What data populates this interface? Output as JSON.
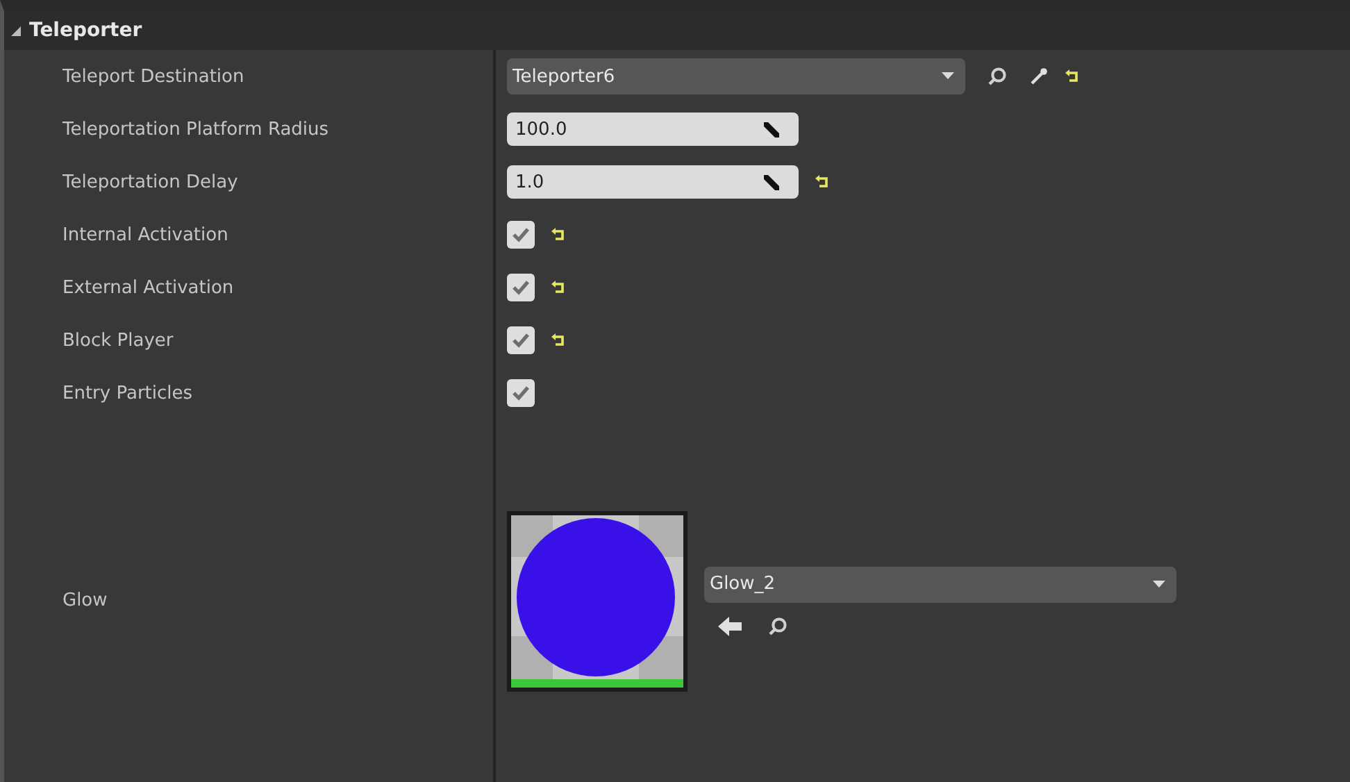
{
  "section": {
    "title": "Teleporter",
    "expanded": true
  },
  "properties": [
    {
      "kind": "object",
      "label": "Teleport Destination",
      "value": "Teleporter6",
      "reset": true
    },
    {
      "kind": "number",
      "label": "Teleportation Platform Radius",
      "value": "100.0",
      "reset": false
    },
    {
      "kind": "number",
      "label": "Teleportation Delay",
      "value": "1.0",
      "reset": true
    },
    {
      "kind": "checkbox",
      "label": "Internal Activation",
      "checked": true,
      "reset": true
    },
    {
      "kind": "checkbox",
      "label": "External Activation",
      "checked": true,
      "reset": true
    },
    {
      "kind": "checkbox",
      "label": "Block Player",
      "checked": true,
      "reset": true
    },
    {
      "kind": "checkbox",
      "label": "Entry Particles",
      "checked": true,
      "reset": false
    },
    {
      "kind": "asset",
      "label": "Glow",
      "value": "Glow_2",
      "reset": false
    }
  ]
}
